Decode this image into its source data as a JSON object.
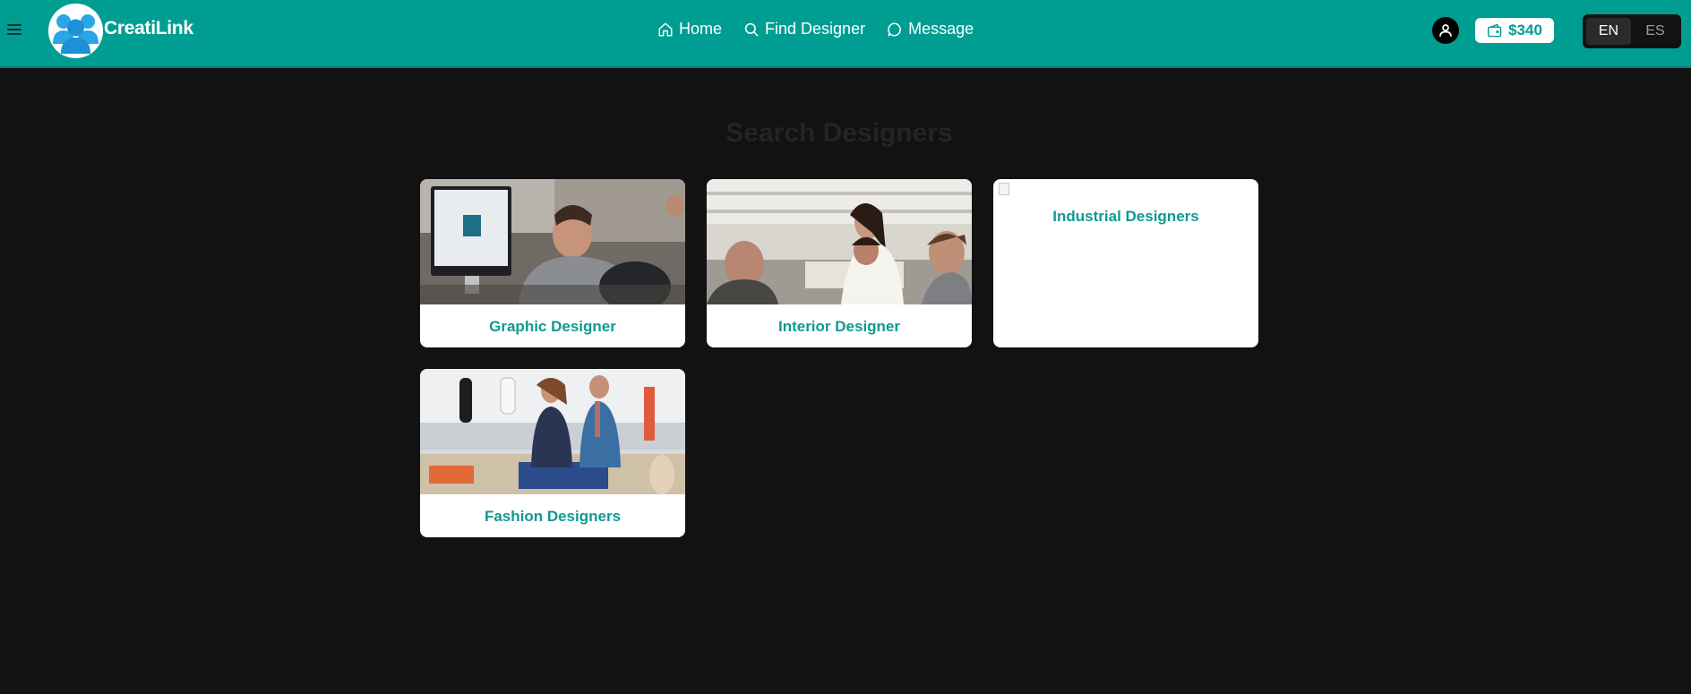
{
  "header": {
    "brand": "CreatiLink",
    "nav": [
      {
        "label": "Home",
        "icon": "home-icon"
      },
      {
        "label": "Find Designer",
        "icon": "search-icon"
      },
      {
        "label": "Message",
        "icon": "message-icon"
      }
    ],
    "wallet_amount": "$340",
    "languages": [
      "EN",
      "ES"
    ],
    "active_language": "EN"
  },
  "main": {
    "title": "Search Designers",
    "categories": [
      {
        "label": "Graphic Designer",
        "image": "graphic-designer-photo"
      },
      {
        "label": "Interior Designer",
        "image": "interior-designer-photo"
      },
      {
        "label": "Industrial Designers",
        "image": "broken-image"
      },
      {
        "label": "Fashion Designers",
        "image": "fashion-designers-photo"
      }
    ]
  },
  "colors": {
    "header_bg": "#009e92",
    "page_bg": "#121212",
    "accent_text": "#0e9a90",
    "card_bg": "#ffffff"
  }
}
